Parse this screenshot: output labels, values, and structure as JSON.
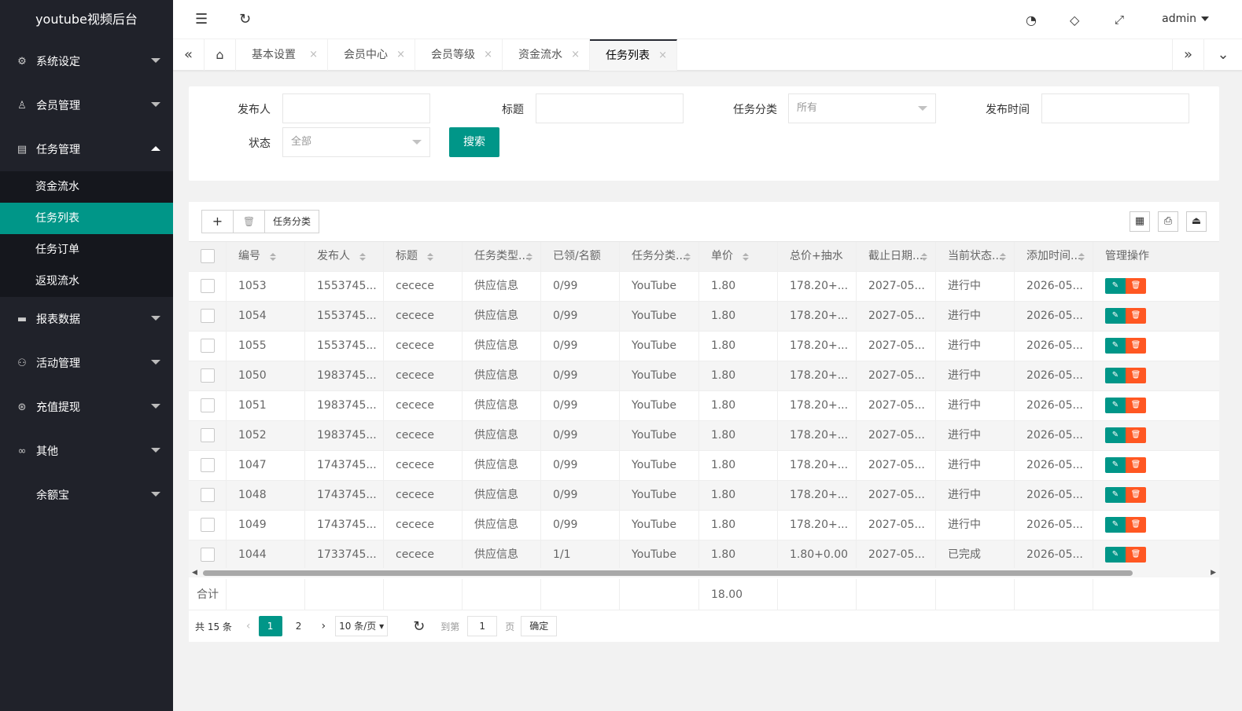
{
  "app": {
    "title": "youtube视频后台"
  },
  "sidebar": {
    "items": [
      {
        "label": "系统设定",
        "icon": "gear-icon"
      },
      {
        "label": "会员管理",
        "icon": "user-icon"
      },
      {
        "label": "任务管理",
        "icon": "file-icon",
        "expanded": true
      },
      {
        "label": "报表数据",
        "icon": "chat-icon"
      },
      {
        "label": "活动管理",
        "icon": "group-icon"
      },
      {
        "label": "充值提现",
        "icon": "dollar-icon"
      },
      {
        "label": "其他",
        "icon": "link-icon"
      },
      {
        "label": "余额宝",
        "icon": ""
      }
    ],
    "subitems": [
      "资金流水",
      "任务列表",
      "任务订单",
      "返现流水"
    ],
    "active_sub": "任务列表"
  },
  "header": {
    "user": "admin"
  },
  "tabs": [
    {
      "label": "基本设置"
    },
    {
      "label": "会员中心"
    },
    {
      "label": "会员等级"
    },
    {
      "label": "资金流水"
    },
    {
      "label": "任务列表",
      "active": true
    }
  ],
  "search": {
    "publisher_label": "发布人",
    "title_label": "标题",
    "category_label": "任务分类",
    "category_value": "所有",
    "time_label": "发布时间",
    "status_label": "状态",
    "status_value": "全部",
    "search_button": "搜索"
  },
  "toolbar": {
    "add": "+",
    "delete": "🗑",
    "category": "任务分类"
  },
  "table": {
    "columns": [
      "编号",
      "发布人",
      "标题",
      "任务类型...",
      "已领/名额",
      "任务分类...",
      "单价",
      "总价+抽水",
      "截止日期...",
      "当前状态...",
      "添加时间...",
      "管理操作"
    ],
    "rows": [
      [
        "1053",
        "1553745...",
        "cecece",
        "供应信息",
        "0/99",
        "YouTube",
        "1.80",
        "178.20+...",
        "2027-05...",
        "进行中",
        "2026-05..."
      ],
      [
        "1054",
        "1553745...",
        "cecece",
        "供应信息",
        "0/99",
        "YouTube",
        "1.80",
        "178.20+...",
        "2027-05...",
        "进行中",
        "2026-05..."
      ],
      [
        "1055",
        "1553745...",
        "cecece",
        "供应信息",
        "0/99",
        "YouTube",
        "1.80",
        "178.20+...",
        "2027-05...",
        "进行中",
        "2026-05..."
      ],
      [
        "1050",
        "1983745...",
        "cecece",
        "供应信息",
        "0/99",
        "YouTube",
        "1.80",
        "178.20+...",
        "2027-05...",
        "进行中",
        "2026-05..."
      ],
      [
        "1051",
        "1983745...",
        "cecece",
        "供应信息",
        "0/99",
        "YouTube",
        "1.80",
        "178.20+...",
        "2027-05...",
        "进行中",
        "2026-05..."
      ],
      [
        "1052",
        "1983745...",
        "cecece",
        "供应信息",
        "0/99",
        "YouTube",
        "1.80",
        "178.20+...",
        "2027-05...",
        "进行中",
        "2026-05..."
      ],
      [
        "1047",
        "1743745...",
        "cecece",
        "供应信息",
        "0/99",
        "YouTube",
        "1.80",
        "178.20+...",
        "2027-05...",
        "进行中",
        "2026-05..."
      ],
      [
        "1048",
        "1743745...",
        "cecece",
        "供应信息",
        "0/99",
        "YouTube",
        "1.80",
        "178.20+...",
        "2027-05...",
        "进行中",
        "2026-05..."
      ],
      [
        "1049",
        "1743745...",
        "cecece",
        "供应信息",
        "0/99",
        "YouTube",
        "1.80",
        "178.20+...",
        "2027-05...",
        "进行中",
        "2026-05..."
      ],
      [
        "1044",
        "1733745...",
        "cecece",
        "供应信息",
        "1/1",
        "YouTube",
        "1.80",
        "1.80+0.00",
        "2027-05...",
        "已完成",
        "2026-05..."
      ]
    ],
    "summary_label": "合计",
    "summary_price": "18.00"
  },
  "pager": {
    "total": "共 15 条",
    "pages": [
      "1",
      "2"
    ],
    "current": "1",
    "size": "10 条/页",
    "goto": "到第",
    "goto_value": "1",
    "page_word": "页",
    "ok": "确定"
  },
  "colors": {
    "accent": "#009688",
    "danger": "#ff5722",
    "sidebar": "#20222a"
  }
}
